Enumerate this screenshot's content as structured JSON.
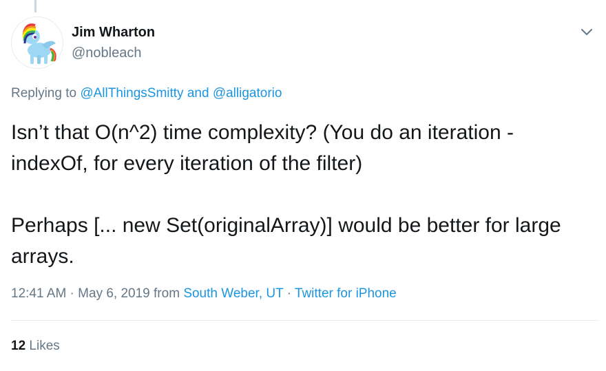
{
  "user": {
    "name": "Jim Wharton",
    "handle": "@nobleach"
  },
  "reply": {
    "prefix": "Replying to ",
    "mention1": "@AllThingsSmitty",
    "conjunction": " and ",
    "mention2": "@alligatorio"
  },
  "tweet": {
    "paragraph1": "Isn’t that O(n^2) time complexity? (You do an iteration - indexOf, for every iteration of the filter)",
    "paragraph2": "Perhaps [... new Set(originalArray)] would be better for large arrays."
  },
  "meta": {
    "time": "12:41 AM",
    "sep1": " · ",
    "date": "May 6, 2019",
    "from": " from ",
    "location": "South Weber, UT",
    "sep2": " · ",
    "source": "Twitter for iPhone"
  },
  "stats": {
    "likes_count": "12",
    "likes_label": " Likes"
  },
  "icons": {
    "caret": "chevron-down-icon",
    "avatar": "pony-avatar"
  },
  "colors": {
    "link": "#1b95e0",
    "muted": "#657786",
    "text": "#14171a",
    "border": "#e6ecf0"
  }
}
